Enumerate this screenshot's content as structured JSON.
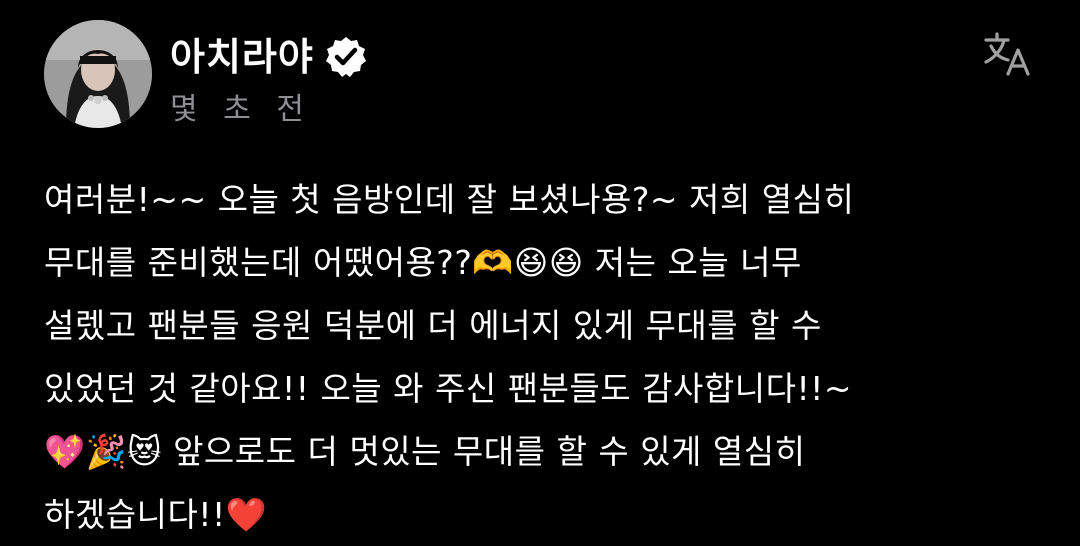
{
  "post": {
    "author_name": "아치라야",
    "verified": true,
    "timestamp": "몇 초 전",
    "body_text": "여러분!~~ 오늘 첫 음방인데 잘 보셨나용?~ 저희 열심히\n무대를 준비했는데 어땠어용??🫶😆😆 저는 오늘 너무\n설렜고 팬분들 응원 덕분에 더 에너지 있게 무대를 할 수\n있었던 것 같아요!! 오늘 와 주신 팬분들도 감사합니다!!~\n💖🎉😻 앞으로도 더 멋있는 무대를 할 수 있게 열심히\n하겠습니다!!❤️"
  },
  "icons": {
    "verified": "verified-badge-icon",
    "translate": "translate-icon"
  },
  "colors": {
    "background": "#000000",
    "text": "#ffffff",
    "secondary_text": "#8e8e93",
    "icon_gray": "#a0a0a0"
  }
}
